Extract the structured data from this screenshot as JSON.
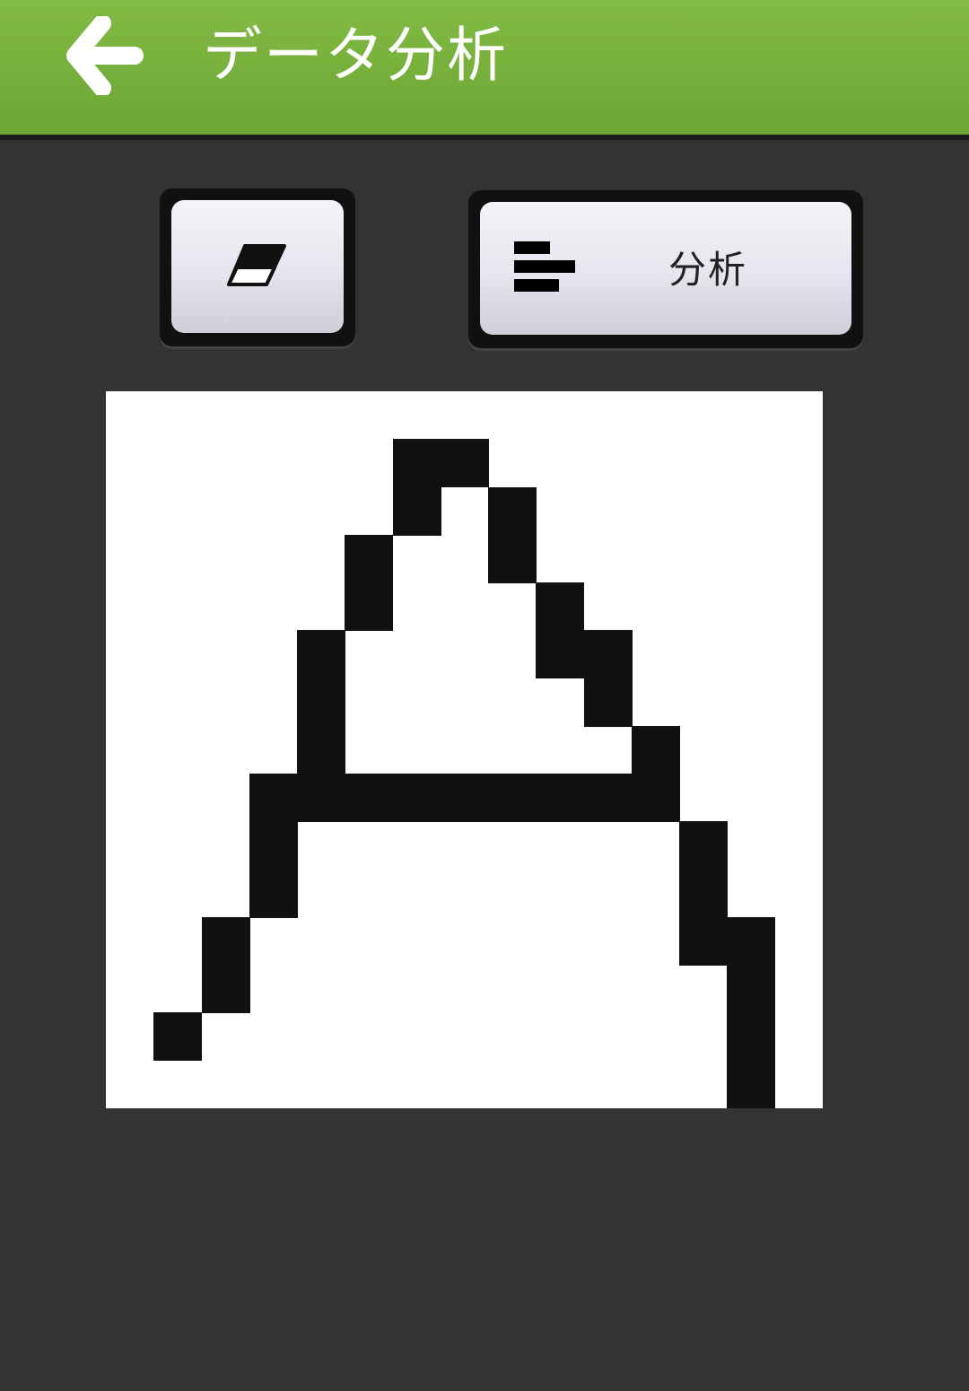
{
  "header": {
    "title": "データ分析",
    "back_icon": "back-arrow-icon",
    "color": "#7ab43e"
  },
  "toolbar": {
    "eraser_icon": "eraser-icon",
    "analyze_icon": "bar-chart-icon",
    "analyze_label": "分析"
  },
  "drawing_grid": {
    "rows": 15,
    "cols": 15,
    "ink_color": "#111111",
    "filled_cells": [
      [
        1,
        6
      ],
      [
        1,
        7
      ],
      [
        2,
        6
      ],
      [
        2,
        8
      ],
      [
        3,
        5
      ],
      [
        3,
        8
      ],
      [
        4,
        5
      ],
      [
        4,
        9
      ],
      [
        5,
        4
      ],
      [
        5,
        9
      ],
      [
        5,
        10
      ],
      [
        6,
        4
      ],
      [
        6,
        10
      ],
      [
        7,
        4
      ],
      [
        7,
        11
      ],
      [
        8,
        3
      ],
      [
        8,
        4
      ],
      [
        8,
        5
      ],
      [
        8,
        6
      ],
      [
        8,
        7
      ],
      [
        8,
        8
      ],
      [
        8,
        9
      ],
      [
        8,
        10
      ],
      [
        8,
        11
      ],
      [
        9,
        3
      ],
      [
        9,
        12
      ],
      [
        10,
        3
      ],
      [
        10,
        12
      ],
      [
        11,
        2
      ],
      [
        11,
        12
      ],
      [
        11,
        13
      ],
      [
        12,
        2
      ],
      [
        12,
        13
      ],
      [
        13,
        1
      ],
      [
        13,
        13
      ],
      [
        14,
        13
      ]
    ]
  }
}
